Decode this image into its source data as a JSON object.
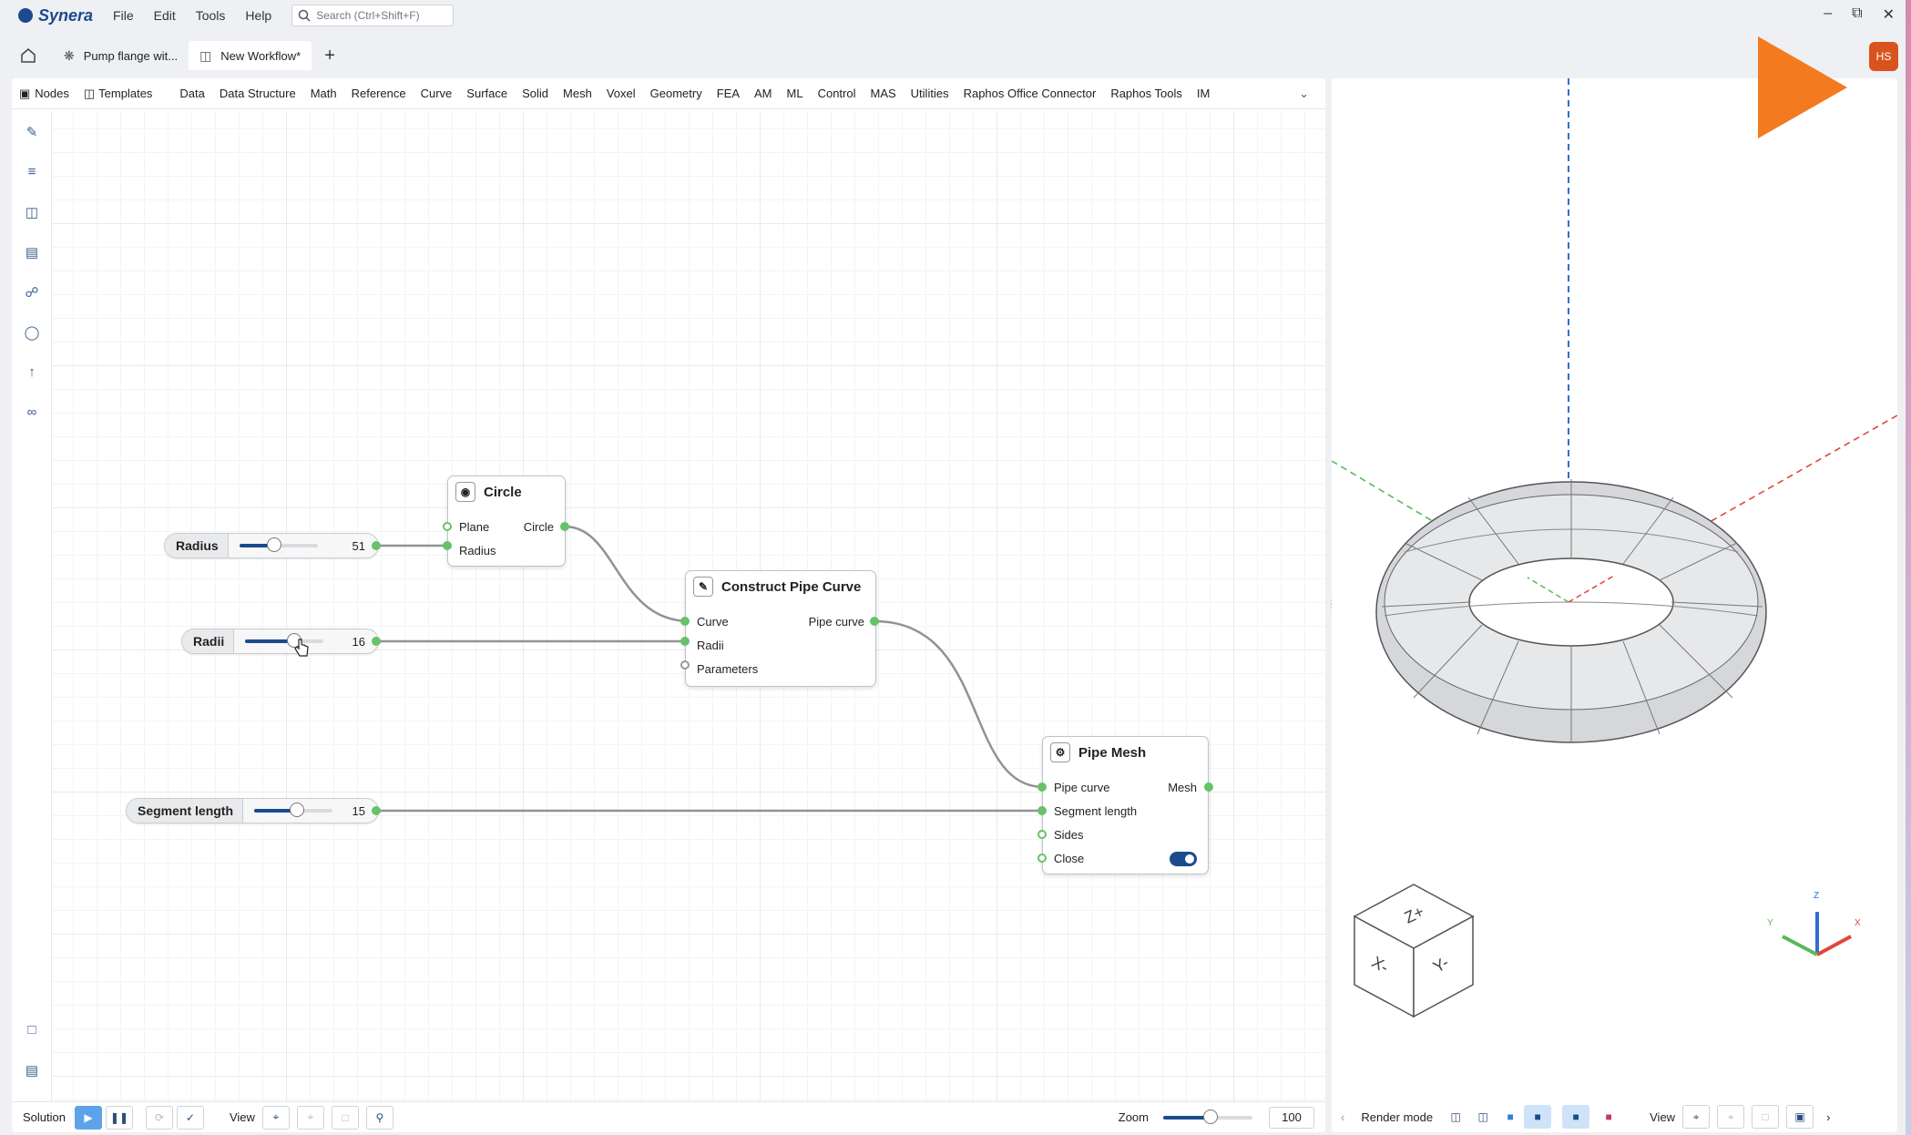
{
  "app": {
    "name": "Synera",
    "menus": [
      "File",
      "Edit",
      "Tools",
      "Help"
    ],
    "search_placeholder": "Search (Ctrl+Shift+F)"
  },
  "tabs": [
    {
      "label": "Pump flange wit..."
    },
    {
      "label": "New Workflow*"
    }
  ],
  "user": {
    "initials": "HS"
  },
  "ribbon": {
    "nodes": "Nodes",
    "templates": "Templates",
    "categories": [
      "Data",
      "Data Structure",
      "Math",
      "Reference",
      "Curve",
      "Surface",
      "Solid",
      "Mesh",
      "Voxel",
      "Geometry",
      "FEA",
      "AM",
      "ML",
      "Control",
      "MAS",
      "Utilities",
      "Raphos Office Connector",
      "Raphos Tools",
      "IM"
    ]
  },
  "sliders": [
    {
      "label": "Radius",
      "value": "51",
      "fraction": 0.45
    },
    {
      "label": "Radii",
      "value": "16",
      "fraction": 0.62
    },
    {
      "label": "Segment length",
      "value": "15",
      "fraction": 0.55
    }
  ],
  "nodes": {
    "circle": {
      "title": "Circle",
      "inputs": [
        "Plane",
        "Radius"
      ],
      "outputs": [
        "Circle"
      ]
    },
    "pipe_curve": {
      "title": "Construct Pipe Curve",
      "inputs": [
        "Curve",
        "Radii",
        "Parameters"
      ],
      "outputs": [
        "Pipe curve"
      ]
    },
    "pipe_mesh": {
      "title": "Pipe Mesh",
      "inputs": [
        "Pipe curve",
        "Segment length",
        "Sides",
        "Close"
      ],
      "outputs": [
        "Mesh"
      ],
      "close_on": true
    }
  },
  "bottom": {
    "solution": "Solution",
    "view": "View",
    "zoom": "Zoom",
    "zoom_value": "100"
  },
  "viewport": {
    "render_mode": "Render mode",
    "view": "View",
    "axis": {
      "z": "Z",
      "x": "X",
      "y": "Y"
    },
    "cube_faces": {
      "top": "Z+",
      "left": "X-",
      "right": "Y-"
    }
  },
  "colors": {
    "accent": "#1b4a8e",
    "port": "#67c26a",
    "orange": "#f47a1f",
    "avatar": "#d9531e"
  }
}
